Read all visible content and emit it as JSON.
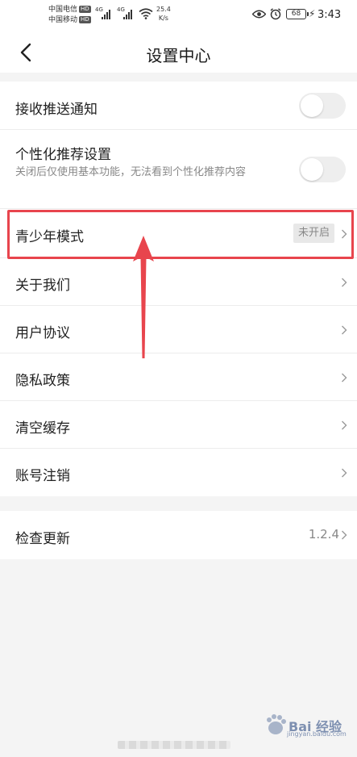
{
  "status_bar": {
    "carrier_1": "中国电信",
    "carrier_2": "中国移动",
    "hd_badge": "HD",
    "network_gen": "4G",
    "net_speed_value": "25.4",
    "net_speed_unit": "K/s",
    "battery_level": "68",
    "time": "3:43"
  },
  "header": {
    "title": "设置中心",
    "back_icon": "chevron-left-icon"
  },
  "settings": {
    "push_notification": {
      "label": "接收推送通知",
      "enabled": false
    },
    "personalized": {
      "label": "个性化推荐设置",
      "description": "关闭后仅使用基本功能，无法看到个性化推荐内容",
      "enabled": false
    },
    "teen_mode": {
      "label": "青少年模式",
      "status": "未开启"
    },
    "about": {
      "label": "关于我们"
    },
    "user_agreement": {
      "label": "用户协议"
    },
    "privacy_policy": {
      "label": "隐私政策"
    },
    "clear_cache": {
      "label": "清空缓存"
    },
    "account_cancel": {
      "label": "账号注销"
    }
  },
  "update": {
    "label": "检查更新",
    "version": "1.2.4"
  },
  "annotation": {
    "highlight_color": "#e8454d"
  },
  "watermark": {
    "text": "Bai 经验",
    "url": "jingyan.baidu.com"
  }
}
